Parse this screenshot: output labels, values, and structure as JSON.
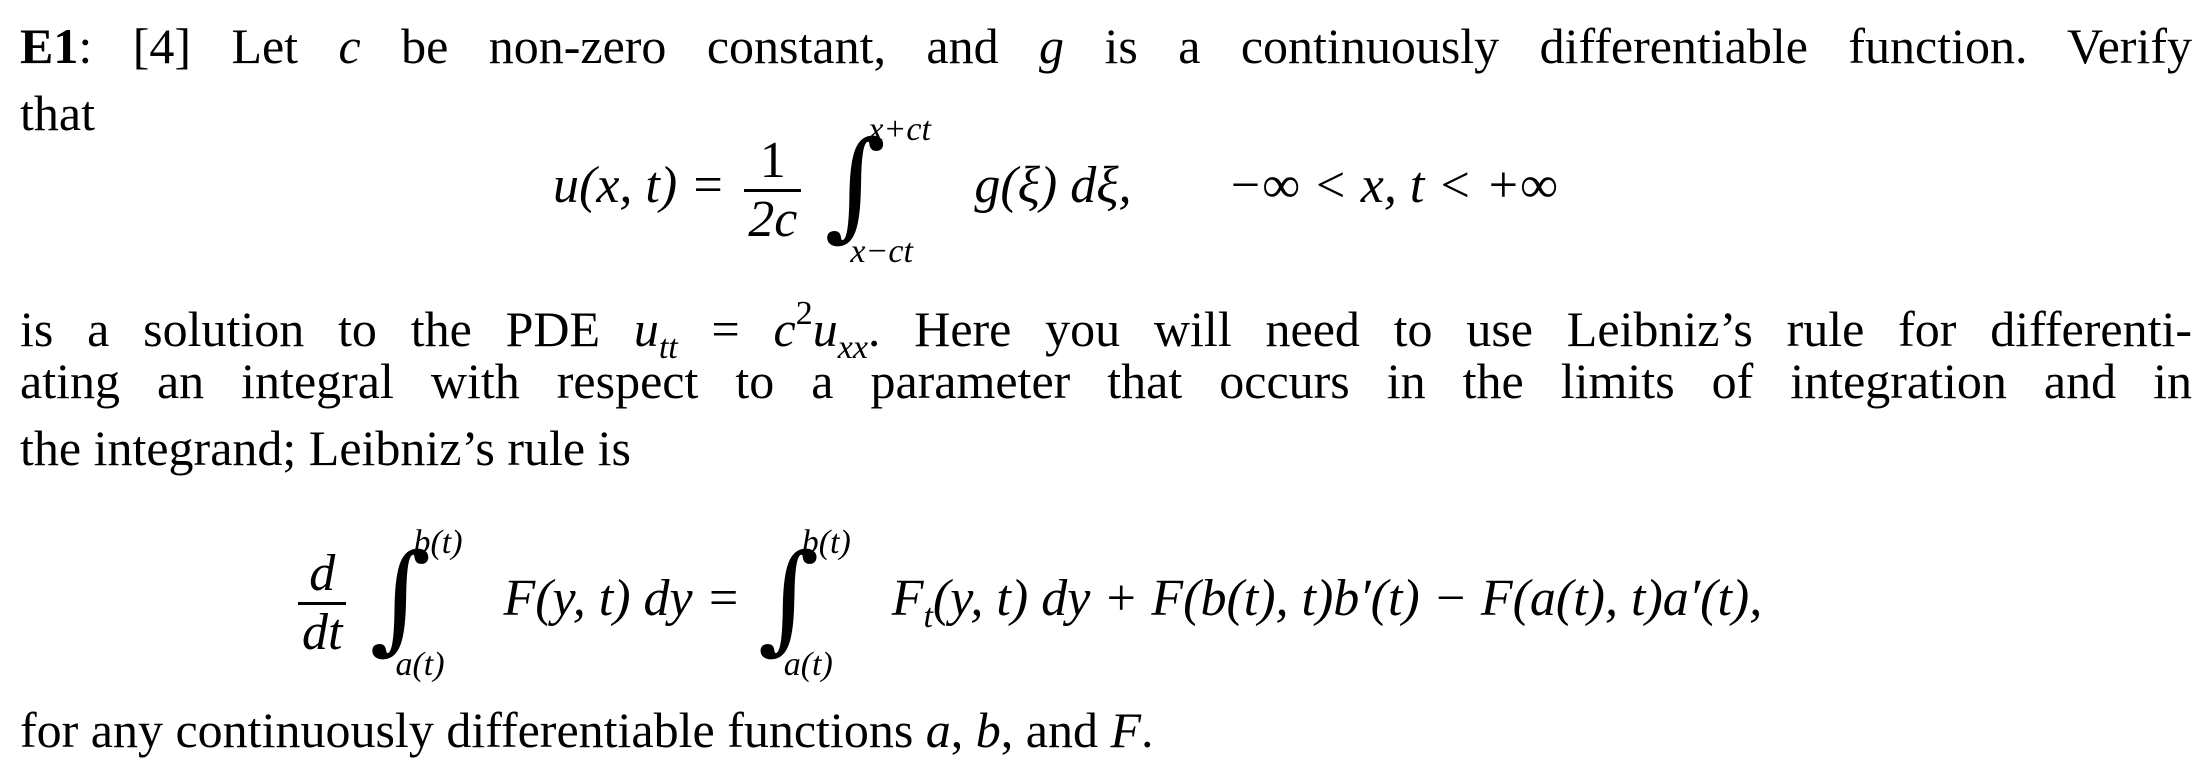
{
  "problem": {
    "label": "E1",
    "label_colon": ":",
    "points": "[4]",
    "line1_rest_a": " Let ",
    "var_c": "c",
    "line1_rest_b": " be non-zero constant, and ",
    "var_g": "g",
    "line1_rest_c": " is a continuously differentiable function.  Verify",
    "line2": "that"
  },
  "equation1": {
    "lhs": "u(x, t) =",
    "frac_num": "1",
    "frac_den": "2c",
    "upper_limit": "x+ct",
    "lower_limit": "x−ct",
    "integrand": "g(ξ) dξ,",
    "domain": "−∞ < x,  t < +∞"
  },
  "paragraph2": {
    "line1_a": "is a solution to the PDE ",
    "pde_u": "u",
    "pde_sub_tt": "tt",
    "pde_eq": " = ",
    "pde_c": "c",
    "pde_sup": "2",
    "pde_u2": "u",
    "pde_sub_xx": "xx",
    "line1_b": ". Here you will need to use Leibniz’s rule for differenti-",
    "line2": "ating an integral with respect to a parameter that occurs in the limits of integration and in",
    "line3": "the integrand; Leibniz’s rule is"
  },
  "equation2": {
    "frac_num": "d",
    "frac_den": "dt",
    "upper_limit": "b(t)",
    "lower_limit": "a(t)",
    "integrand_lhs": "F(y, t) dy =",
    "upper_limit_rhs": "b(t)",
    "lower_limit_rhs": "a(t)",
    "rhs_F": "F",
    "rhs_sub_t": "t",
    "rhs_rest": "(y, t) dy + F(b(t), t)b′(t) − F(a(t), t)a′(t),"
  },
  "closing": {
    "text_a": "for any continuously differentiable functions ",
    "var_a": "a",
    "sep1": ", ",
    "var_b": "b",
    "sep2": ", and ",
    "var_F": "F",
    "period": "."
  }
}
